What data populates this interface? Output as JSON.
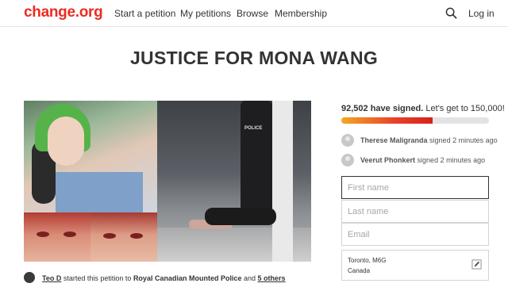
{
  "header": {
    "logo": "change.org",
    "nav": [
      "Start a petition",
      "My petitions",
      "Browse",
      "Membership"
    ],
    "login": "Log in",
    "icons": {
      "search": "search-icon"
    }
  },
  "petition": {
    "title": "JUSTICE FOR MONA WANG",
    "media_overlay_text": "POLICE",
    "signed_count": "92,502 have signed.",
    "goal_text": "Let's get to 150,000!",
    "progress": 0.62,
    "recent_signers": [
      {
        "name": "Therese Maligranda",
        "action": "signed 2 minutes ago"
      },
      {
        "name": "Veerut Phonkert",
        "action": "signed 2 minutes ago"
      }
    ],
    "form": {
      "first_name_placeholder": "First name",
      "last_name_placeholder": "Last name",
      "email_placeholder": "Email",
      "city": "Toronto, M6G",
      "country": "Canada"
    },
    "starter": {
      "name": "Teo D",
      "text_a": "started this petition to",
      "target": "Royal Canadian Mounted Police",
      "text_b": "and",
      "others": "5 others"
    }
  },
  "colors": {
    "brand": "#ec2c22",
    "progress_start": "#f5a623",
    "progress_end": "#d6221b"
  }
}
